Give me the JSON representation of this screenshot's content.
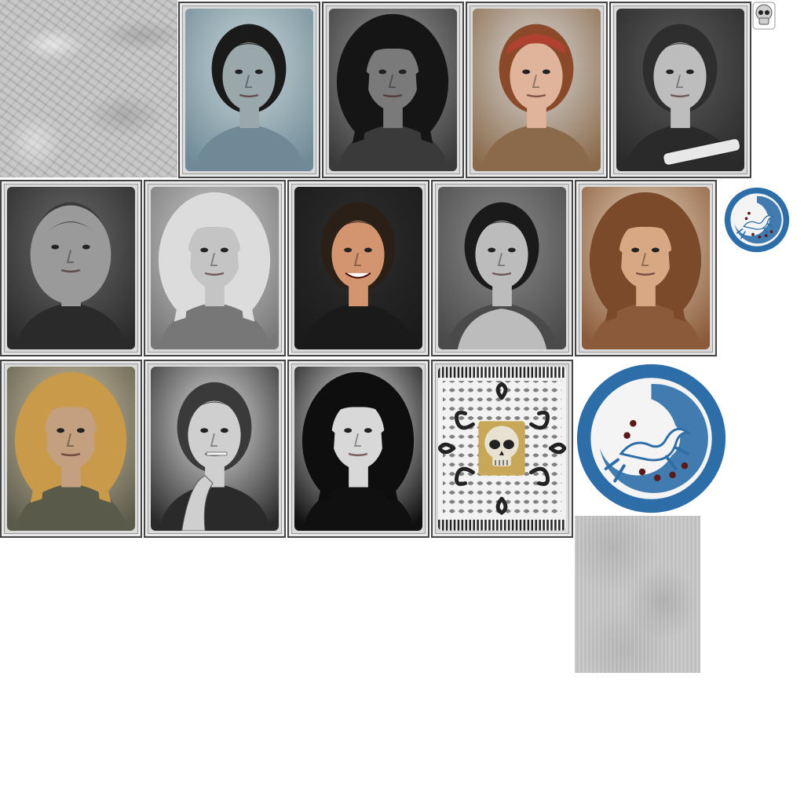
{
  "sheet": {
    "background_color": "#ffffff",
    "frame_color": "#444444",
    "card_face_color": "#d9d9d9"
  },
  "cards": [
    {
      "id": "card-1",
      "tone": "#6f8a96",
      "skin": "#9aa7ab",
      "hair": "#1a1a1a",
      "bg": "#c9d6da",
      "style": "slick"
    },
    {
      "id": "card-2",
      "tone": "#3a3a3a",
      "skin": "#7a7a7a",
      "hair": "#151515",
      "bg": "#9a9a9a",
      "style": "wild"
    },
    {
      "id": "card-3",
      "tone": "#8a6a4a",
      "skin": "#e0b49a",
      "hair": "#8a4a2a",
      "bg": "#d8d8d8",
      "style": "bandana"
    },
    {
      "id": "card-4",
      "tone": "#2a2a2a",
      "skin": "#bdbdbd",
      "hair": "#2e2e2e",
      "bg": "#5a5a5a",
      "style": "guitar"
    },
    {
      "id": "card-5",
      "tone": "#2a2a2a",
      "skin": "#9a9a9a",
      "hair": "#3a3a3a",
      "bg": "#6a6a6a",
      "style": "closeup"
    },
    {
      "id": "card-6",
      "tone": "#777777",
      "skin": "#c4c4c4",
      "hair": "#dcdcdc",
      "bg": "#cfcfcf",
      "style": "curly"
    },
    {
      "id": "card-7",
      "tone": "#1a1a1a",
      "skin": "#d39470",
      "hair": "#2a2018",
      "bg": "#2e2e2e",
      "style": "smile"
    },
    {
      "id": "card-8",
      "tone": "#4a4a4a",
      "skin": "#bcbcbc",
      "hair": "#1a1a1a",
      "bg": "#8a8a8a",
      "style": "shirtless"
    },
    {
      "id": "card-9",
      "tone": "#8a5a3a",
      "skin": "#d8a884",
      "hair": "#7a4a2a",
      "bg": "#e8d8c0",
      "style": "long"
    },
    {
      "id": "card-10",
      "tone": "#5a5a4a",
      "skin": "#c4a080",
      "hair": "#c89a4a",
      "bg": "#d6c6a8",
      "style": "curly"
    },
    {
      "id": "card-11",
      "tone": "#2a2a2a",
      "skin": "#cfcfcf",
      "hair": "#3a3a3a",
      "bg": "#e0e0e0",
      "style": "smoke"
    },
    {
      "id": "card-12",
      "tone": "#101010",
      "skin": "#d8d8d8",
      "hair": "#0e0e0e",
      "bg": "#f0f0f0",
      "style": "wild"
    }
  ],
  "card_back": {
    "id": "card-back",
    "pattern_color": "#222222",
    "skull_color": "#e8e2d2"
  },
  "logos": [
    {
      "id": "logo-small",
      "color": "#2d6ea8"
    },
    {
      "id": "logo-large",
      "color": "#2d6ea8"
    }
  ],
  "icons": {
    "skull": "skull-icon",
    "lizard": "lizard-icon"
  }
}
